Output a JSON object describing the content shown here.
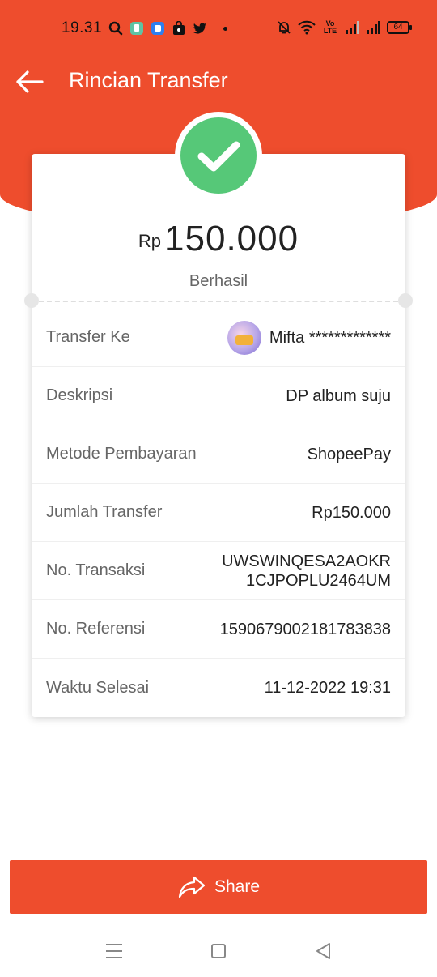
{
  "status_bar": {
    "time": "19.31",
    "notification_icons": [
      "search-icon",
      "chat-app-icon",
      "blue-app-icon",
      "shop-bag-icon",
      "twitter-icon"
    ],
    "right_icons": [
      "mute-bell-icon",
      "wifi-icon",
      "volte-icon",
      "signal-icon",
      "signal-icon"
    ],
    "volte_label": "Vo LTE",
    "battery": "64"
  },
  "header": {
    "title": "Rincian Transfer"
  },
  "summary": {
    "currency": "Rp",
    "amount": "150.000",
    "status": "Berhasil"
  },
  "details": {
    "transfer_to_label": "Transfer Ke",
    "transfer_to_value": "Mifta *************",
    "description_label": "Deskripsi",
    "description_value": "DP album suju",
    "payment_method_label": "Metode Pembayaran",
    "payment_method_value": "ShopeePay",
    "amount_label": "Jumlah Transfer",
    "amount_value": "Rp150.000",
    "transaction_no_label": "No. Transaksi",
    "transaction_no_line1": "UWSWINQESA2AOKR",
    "transaction_no_line2": "1CJPOPLU2464UM",
    "reference_no_label": "No. Referensi",
    "reference_no_value": "1590679002181783838",
    "completed_time_label": "Waktu Selesai",
    "completed_time_value": "11-12-2022 19:31"
  },
  "actions": {
    "share_label": "Share"
  },
  "colors": {
    "brand": "#ee4d2d",
    "success": "#56c878"
  }
}
